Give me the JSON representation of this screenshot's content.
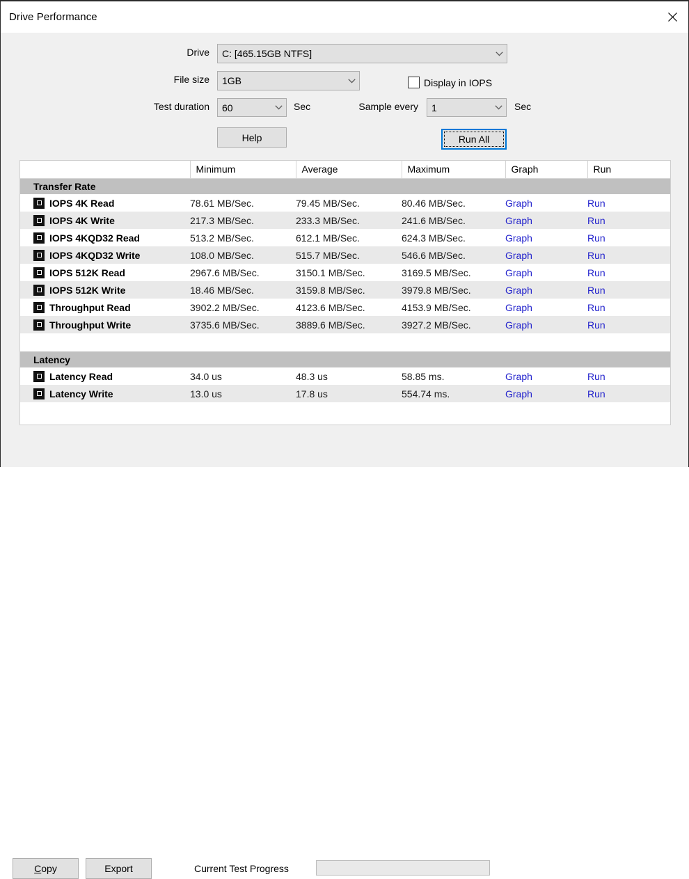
{
  "window": {
    "title": "Drive Performance",
    "close_icon": "close-icon"
  },
  "controls": {
    "drive_label": "Drive",
    "drive_value": "C: [465.15GB NTFS]",
    "filesize_label": "File size",
    "filesize_value": "1GB",
    "duration_label": "Test duration",
    "duration_value": "60",
    "duration_unit": "Sec",
    "display_iops_label": "Display in IOPS",
    "display_iops_checked": false,
    "sample_label": "Sample every",
    "sample_value": "1",
    "sample_unit": "Sec",
    "help_label": "Help",
    "run_all_label": "Run All"
  },
  "table": {
    "headers": [
      "",
      "Minimum",
      "Average",
      "Maximum",
      "Graph",
      "Run"
    ],
    "sections": [
      {
        "title": "Transfer Rate",
        "rows": [
          {
            "name": "IOPS 4K Read",
            "min": "78.61 MB/Sec.",
            "avg": "79.45 MB/Sec.",
            "max": "80.46 MB/Sec.",
            "graph": "Graph",
            "run": "Run"
          },
          {
            "name": "IOPS 4K Write",
            "min": "217.3 MB/Sec.",
            "avg": "233.3 MB/Sec.",
            "max": "241.6 MB/Sec.",
            "graph": "Graph",
            "run": "Run"
          },
          {
            "name": "IOPS 4KQD32 Read",
            "min": "513.2 MB/Sec.",
            "avg": "612.1 MB/Sec.",
            "max": "624.3 MB/Sec.",
            "graph": "Graph",
            "run": "Run"
          },
          {
            "name": "IOPS 4KQD32 Write",
            "min": "108.0 MB/Sec.",
            "avg": "515.7 MB/Sec.",
            "max": "546.6 MB/Sec.",
            "graph": "Graph",
            "run": "Run"
          },
          {
            "name": "IOPS 512K Read",
            "min": "2967.6 MB/Sec.",
            "avg": "3150.1 MB/Sec.",
            "max": "3169.5 MB/Sec.",
            "graph": "Graph",
            "run": "Run"
          },
          {
            "name": "IOPS 512K Write",
            "min": "18.46 MB/Sec.",
            "avg": "3159.8 MB/Sec.",
            "max": "3979.8 MB/Sec.",
            "graph": "Graph",
            "run": "Run"
          },
          {
            "name": "Throughput Read",
            "min": "3902.2 MB/Sec.",
            "avg": "4123.6 MB/Sec.",
            "max": "4153.9 MB/Sec.",
            "graph": "Graph",
            "run": "Run"
          },
          {
            "name": "Throughput Write",
            "min": "3735.6 MB/Sec.",
            "avg": "3889.6 MB/Sec.",
            "max": "3927.2 MB/Sec.",
            "graph": "Graph",
            "run": "Run"
          }
        ]
      },
      {
        "title": "Latency",
        "rows": [
          {
            "name": "Latency Read",
            "min": "34.0 us",
            "avg": "48.3 us",
            "max": "58.85 ms.",
            "graph": "Graph",
            "run": "Run"
          },
          {
            "name": "Latency Write",
            "min": "13.0 us",
            "avg": "17.8 us",
            "max": "554.74 ms.",
            "graph": "Graph",
            "run": "Run"
          }
        ]
      }
    ]
  },
  "footer": {
    "copy_label": "Copy",
    "copy_accel": "C",
    "copy_rest": "opy",
    "export_label": "Export",
    "progress_label": "Current Test Progress",
    "progress_percent": 0
  },
  "colors": {
    "link": "#2020cc",
    "section_header_bg": "#c0c0c0",
    "alt_row_bg": "#e9e9e9",
    "focus_border": "#0078d7",
    "panel_bg": "#f0f0f0"
  }
}
